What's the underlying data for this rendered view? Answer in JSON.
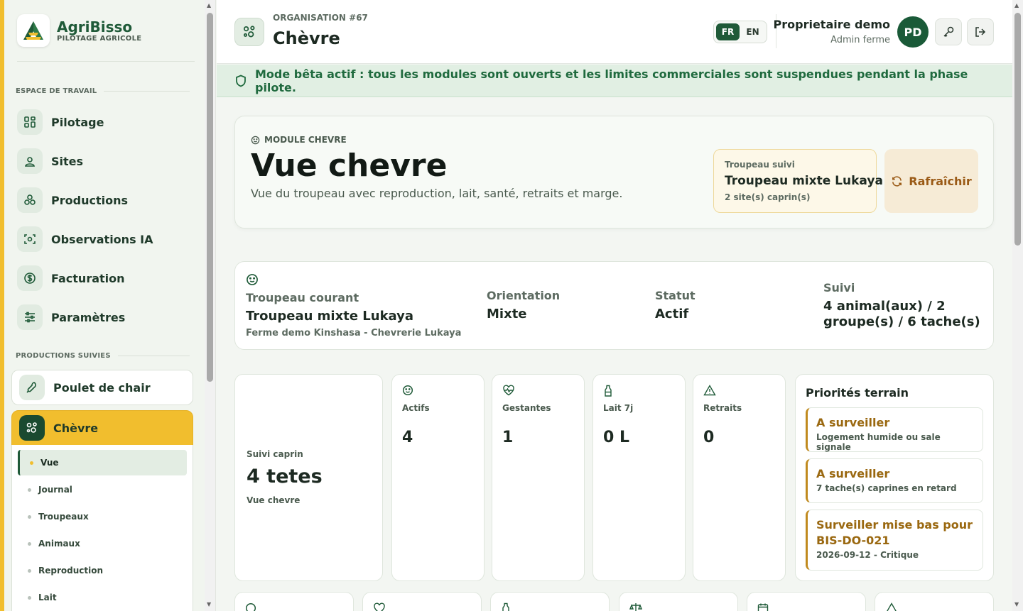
{
  "brand": {
    "name": "AgriBisso",
    "subtitle": "PILOTAGE AGRICOLE"
  },
  "sidebar": {
    "workspace_label": "ESPACE DE TRAVAIL",
    "items": [
      {
        "label": "Pilotage",
        "icon": "grid-icon"
      },
      {
        "label": "Sites",
        "icon": "location-icon"
      },
      {
        "label": "Productions",
        "icon": "production-icon"
      },
      {
        "label": "Observations IA",
        "icon": "scan-icon"
      },
      {
        "label": "Facturation",
        "icon": "dollar-icon"
      },
      {
        "label": "Paramètres",
        "icon": "sliders-icon"
      }
    ],
    "productions_label": "PRODUCTIONS SUIVIES",
    "productions": [
      {
        "label": "Poulet de chair",
        "icon": "chicken-icon"
      },
      {
        "label": "Chèvre",
        "icon": "goat-icon",
        "active": true
      }
    ],
    "submenu": [
      "Vue",
      "Journal",
      "Troupeaux",
      "Animaux",
      "Reproduction",
      "Lait"
    ]
  },
  "header": {
    "org_label": "ORGANISATION #67",
    "title": "Chèvre",
    "lang_fr": "FR",
    "lang_en": "EN",
    "user_name": "Proprietaire demo",
    "user_role": "Admin ferme",
    "avatar_initials": "PD"
  },
  "beta_banner": "Mode bêta actif : tous les modules sont ouverts et les limites commerciales sont suspendues pendant la phase pilote.",
  "hero": {
    "tag": "MODULE CHEVRE",
    "title": "Vue chevre",
    "description": "Vue du troupeau avec reproduction, lait, santé, retraits et marge.",
    "herd_label": "Troupeau suivi",
    "herd_name": "Troupeau mixte Lukaya",
    "herd_sites": "2 site(s) caprin(s)",
    "refresh_label": "Rafraîchir"
  },
  "info": {
    "current_label": "Troupeau courant",
    "current_value": "Troupeau mixte Lukaya",
    "current_sub": "Ferme demo Kinshasa - Chevrerie Lukaya",
    "orientation_label": "Orientation",
    "orientation_value": "Mixte",
    "status_label": "Statut",
    "status_value": "Actif",
    "tracking_label": "Suivi",
    "tracking_line1": "4 animal(aux) / 2",
    "tracking_line2": "groupe(s) / 6 tache(s)"
  },
  "summary": {
    "label": "Suivi caprin",
    "value": "4 tetes",
    "sub": "Vue chevre"
  },
  "stats": [
    {
      "label": "Actifs",
      "value": "4",
      "icon": "smile-icon"
    },
    {
      "label": "Gestantes",
      "value": "1",
      "icon": "heart-pulse-icon"
    },
    {
      "label": "Lait 7j",
      "value": "0 L",
      "icon": "bottle-icon"
    },
    {
      "label": "Retraits",
      "value": "0",
      "icon": "warning-icon"
    }
  ],
  "priorities": {
    "title": "Priorités terrain",
    "items": [
      {
        "title": "A surveiller",
        "detail": "Logement humide ou sale signale"
      },
      {
        "title": "A surveiller",
        "detail": "7 tache(s) caprines en retard"
      },
      {
        "title": "Surveiller mise bas pour BIS-DO-021",
        "detail": "2026-09-12 - Critique"
      }
    ]
  },
  "colors": {
    "brand_green": "#1f5a38",
    "accent_yellow": "#f1be2e",
    "banner_green": "#1f6a3e",
    "warning_text": "#9a6810"
  }
}
